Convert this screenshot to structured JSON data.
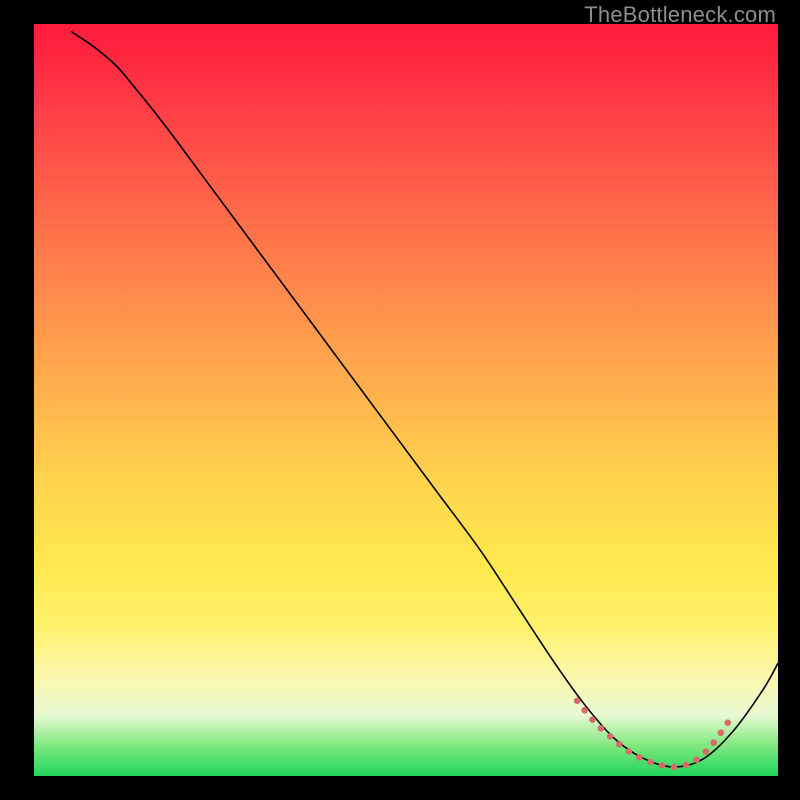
{
  "watermark": "TheBottleneck.com",
  "chart_data": {
    "type": "line",
    "title": "",
    "xlabel": "",
    "ylabel": "",
    "xlim": [
      0,
      100
    ],
    "ylim": [
      0,
      100
    ],
    "grid": false,
    "series": [
      {
        "name": "bottleneck-curve",
        "stroke": "#000000",
        "stroke_width": 1.6,
        "x": [
          5,
          8,
          11,
          14,
          18,
          24,
          30,
          36,
          42,
          48,
          54,
          60,
          65,
          70,
          74,
          78,
          82,
          86,
          90,
          94,
          98,
          100
        ],
        "y": [
          99,
          97,
          94.5,
          91,
          86,
          78,
          70,
          62,
          54,
          46,
          38,
          30,
          22.5,
          15,
          9.5,
          5,
          2.3,
          1.2,
          2.3,
          6,
          11.5,
          15
        ]
      },
      {
        "name": "optimal-band",
        "stroke": "#d96a6a",
        "stroke_width": 6.5,
        "linecap": "round",
        "dash": "0.1 12",
        "x": [
          73,
          75.5,
          78,
          80,
          82,
          84,
          86,
          88,
          89.5,
          91,
          92.5,
          94
        ],
        "y": [
          10,
          7,
          4.8,
          3.2,
          2.2,
          1.5,
          1.2,
          1.6,
          2.5,
          4,
          6,
          8.2
        ]
      }
    ],
    "background_gradient": {
      "orientation": "vertical",
      "stops": [
        {
          "pos": 0.0,
          "color": "#ff1a3c"
        },
        {
          "pos": 0.1,
          "color": "#ff3a45"
        },
        {
          "pos": 0.25,
          "color": "#ff6a4a"
        },
        {
          "pos": 0.45,
          "color": "#ffa64d"
        },
        {
          "pos": 0.6,
          "color": "#ffd24d"
        },
        {
          "pos": 0.72,
          "color": "#ffe94d"
        },
        {
          "pos": 0.8,
          "color": "#fff26b"
        },
        {
          "pos": 0.87,
          "color": "#fbf8b0"
        },
        {
          "pos": 0.92,
          "color": "#e6f9d0"
        },
        {
          "pos": 0.96,
          "color": "#7fe87f"
        },
        {
          "pos": 1.0,
          "color": "#1fd65a"
        }
      ]
    }
  }
}
